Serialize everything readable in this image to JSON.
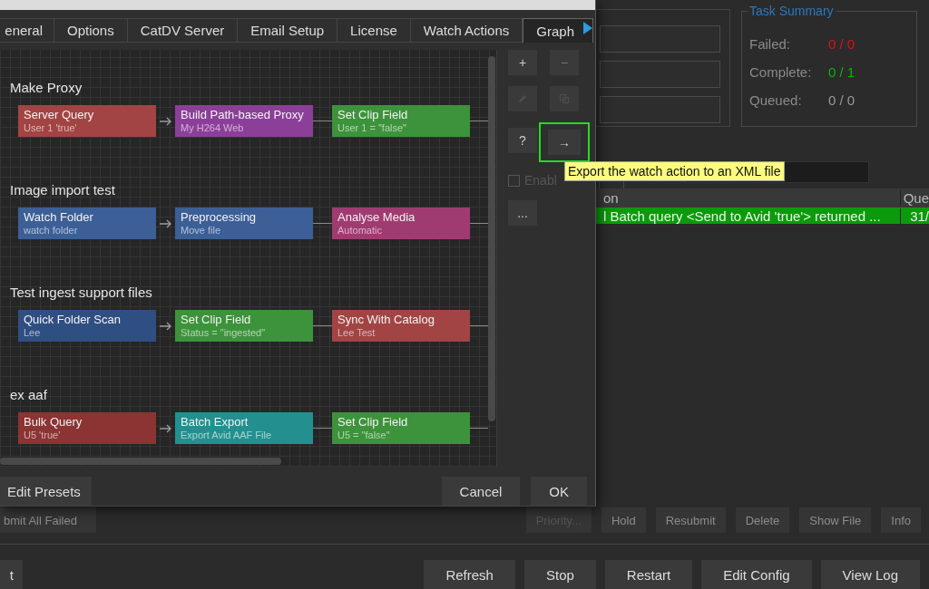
{
  "dialog": {
    "tabs": [
      {
        "label": "eneral",
        "selected": false
      },
      {
        "label": "Options",
        "selected": false
      },
      {
        "label": "CatDV Server",
        "selected": false
      },
      {
        "label": "Email Setup",
        "selected": false
      },
      {
        "label": "License",
        "selected": false
      },
      {
        "label": "Watch Actions",
        "selected": false
      },
      {
        "label": "Graph",
        "selected": true
      }
    ],
    "workflows": [
      {
        "title": "Make Proxy",
        "steps": [
          {
            "name": "Server Query",
            "detail": "User 1 'true'",
            "color": "#a34444"
          },
          {
            "name": "Build Path-based Proxy",
            "detail": "My H264 Web",
            "color": "#8c3f99"
          },
          {
            "name": "Set Clip Field",
            "detail": "User 1 = \"false\"",
            "color": "#3d933b"
          }
        ]
      },
      {
        "title": "Image import test",
        "steps": [
          {
            "name": "Watch Folder",
            "detail": "watch folder",
            "color": "#3b5f96"
          },
          {
            "name": "Preprocessing",
            "detail": "Move file",
            "color": "#3b5f96"
          },
          {
            "name": "Analyse Media",
            "detail": "Automatic",
            "color": "#a03b72"
          }
        ]
      },
      {
        "title": "Test ingest support files",
        "steps": [
          {
            "name": "Quick Folder Scan",
            "detail": "Lee",
            "color": "#2f4f82"
          },
          {
            "name": "Set Clip Field",
            "detail": "Status = \"ingested\"",
            "color": "#3d933b"
          },
          {
            "name": "Sync With Catalog",
            "detail": "Lee Test",
            "color": "#a34444"
          }
        ]
      },
      {
        "title": "ex aaf",
        "steps": [
          {
            "name": "Bulk Query",
            "detail": "U5 'true'",
            "color": "#8c3333"
          },
          {
            "name": "Batch Export",
            "detail": "Export Avid AAF File",
            "color": "#23908f"
          },
          {
            "name": "Set Clip Field",
            "detail": "U5 = \"false\"",
            "color": "#3d933b"
          }
        ]
      }
    ],
    "side_buttons": [
      {
        "kind": "text",
        "label": "+",
        "disabled": false,
        "highlighted": false
      },
      {
        "kind": "text",
        "label": "−",
        "disabled": true,
        "highlighted": false
      },
      {
        "kind": "pencil",
        "disabled": true,
        "highlighted": false
      },
      {
        "kind": "copy",
        "disabled": true,
        "highlighted": false
      },
      {
        "kind": "text",
        "label": "?",
        "disabled": false,
        "highlighted": false
      },
      {
        "kind": "text",
        "label": "→",
        "disabled": false,
        "highlighted": true
      }
    ],
    "enable_checkbox": {
      "label": "Enabl",
      "checked": false,
      "disabled": true
    },
    "more_button": {
      "label": "..."
    },
    "tooltip": "Export the watch action to an XML file",
    "footer": {
      "left_buttons": [
        "Edit Presets"
      ],
      "right_buttons": [
        "Cancel",
        "OK"
      ]
    }
  },
  "background": {
    "task_summary": {
      "title": "Task Summary",
      "rows": [
        {
          "label": "Failed:",
          "value": "0 / 0",
          "color": "#e01010"
        },
        {
          "label": "Complete:",
          "value": "0 / 1",
          "color": "#10b010"
        },
        {
          "label": "Queued:",
          "value": "0 / 0",
          "color": "#9a9a9a"
        }
      ]
    },
    "table": {
      "columns": [
        "on",
        "Que"
      ],
      "rows": [
        {
          "selected": true,
          "cells": [
            "l Batch query <Send to Avid 'true'> returned ...",
            "31/"
          ]
        }
      ]
    },
    "action_buttons": [
      {
        "label": "bmit All Failed",
        "disabled": false
      },
      {
        "label": "Priority...",
        "disabled": true
      },
      {
        "label": "Hold",
        "disabled": false
      },
      {
        "label": "Resubmit",
        "disabled": false
      },
      {
        "label": "Delete",
        "disabled": false
      },
      {
        "label": "Show File",
        "disabled": false
      },
      {
        "label": "Info",
        "disabled": false
      }
    ],
    "bottom_buttons": [
      "t",
      "Refresh",
      "Stop",
      "Restart",
      "Edit Config",
      "View Log"
    ]
  }
}
